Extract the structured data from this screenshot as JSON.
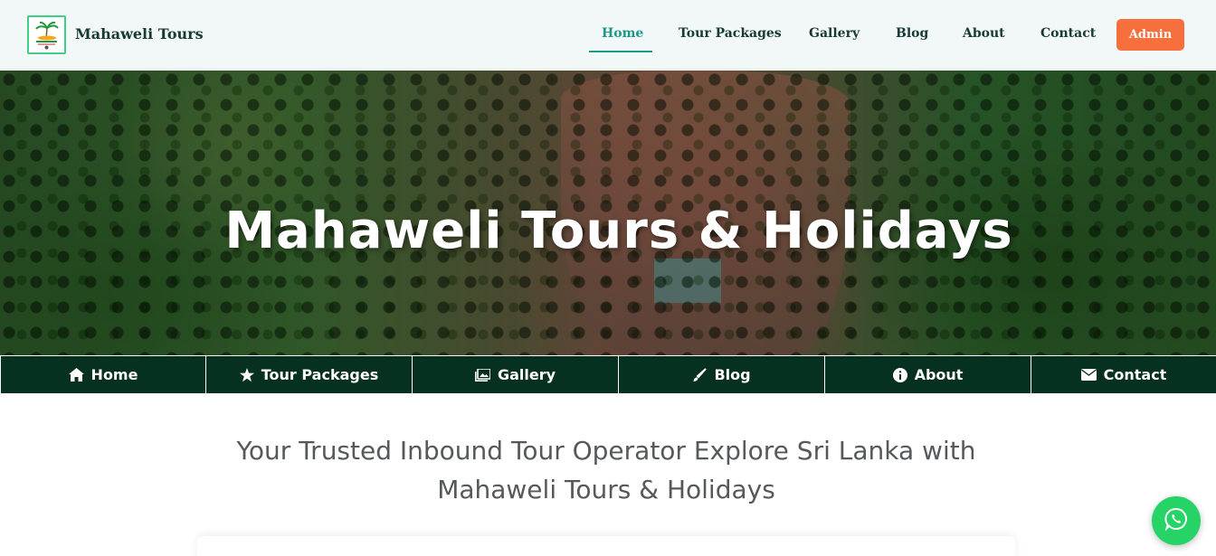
{
  "brand": {
    "name": "Mahaweli Tours",
    "logo_icon": "palm-tree-logo-icon"
  },
  "topnav": {
    "items": [
      {
        "label": "Home",
        "active": true
      },
      {
        "label": "Tour Packages"
      },
      {
        "label": "Gallery"
      },
      {
        "label": "Blog"
      },
      {
        "label": "About"
      },
      {
        "label": "Contact"
      }
    ],
    "admin_label": "Admin",
    "active_color": "#1a9a86",
    "admin_color": "#f86f3e"
  },
  "hero": {
    "title": "Mahaweli Tours & Holidays"
  },
  "subnav": {
    "items": [
      {
        "label": "Home",
        "icon": "home-icon"
      },
      {
        "label": "Tour Packages",
        "icon": "star-icon"
      },
      {
        "label": "Gallery",
        "icon": "images-icon"
      },
      {
        "label": "Blog",
        "icon": "brush-icon"
      },
      {
        "label": "About",
        "icon": "info-icon"
      },
      {
        "label": "Contact",
        "icon": "envelope-icon"
      }
    ],
    "background": "#06301f"
  },
  "tagline": {
    "line1": "Your Trusted Inbound Tour Operator Explore Sri Lanka with",
    "line2": "Mahaweli Tours & Holidays"
  },
  "floating": {
    "whatsapp_icon": "whatsapp-icon",
    "color": "#25d366"
  }
}
